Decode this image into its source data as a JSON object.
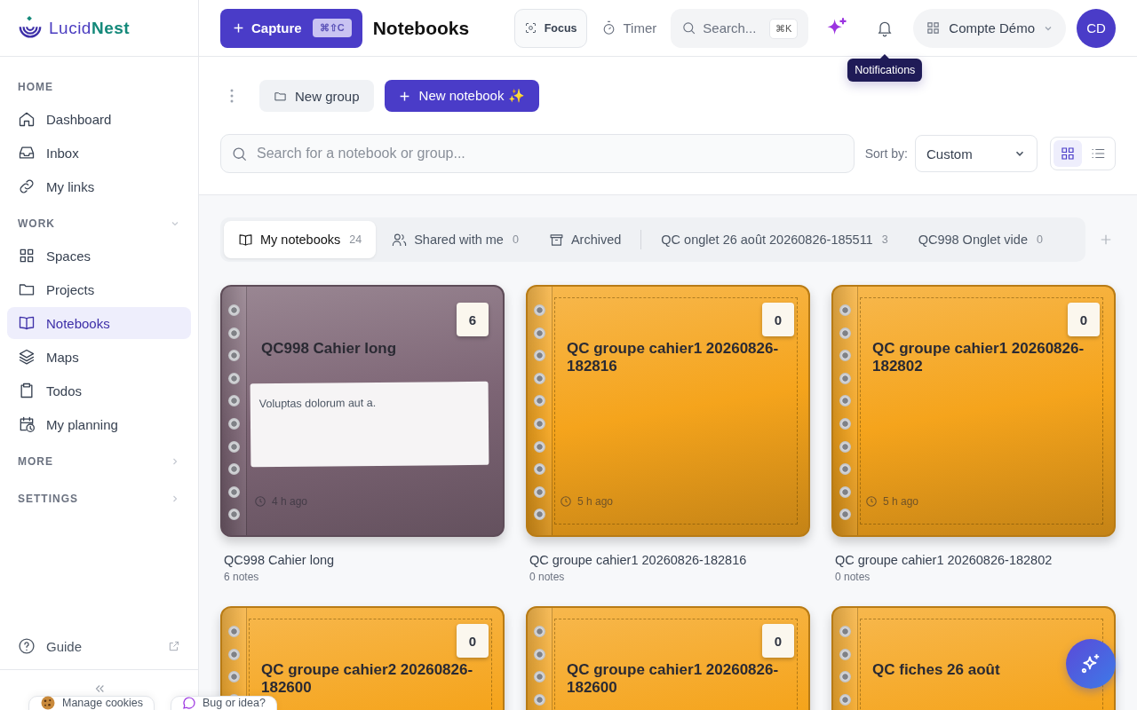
{
  "logo": {
    "first": "Lucid",
    "second": "Nest"
  },
  "sidebar": {
    "sections": [
      {
        "title": "HOME",
        "kind": "fixed",
        "items": [
          {
            "label": "Dashboard",
            "selected": false
          },
          {
            "label": "Inbox",
            "selected": false
          },
          {
            "label": "My links",
            "selected": false
          }
        ]
      },
      {
        "title": "WORK",
        "kind": "collapsible",
        "expanded": true,
        "items": [
          {
            "label": "Spaces",
            "selected": false
          },
          {
            "label": "Projects",
            "selected": false
          },
          {
            "label": "Notebooks",
            "selected": true
          },
          {
            "label": "Maps",
            "selected": false
          },
          {
            "label": "Todos",
            "selected": false
          },
          {
            "label": "My planning",
            "selected": false
          }
        ]
      },
      {
        "title": "MORE",
        "kind": "collapsible",
        "expanded": false
      },
      {
        "title": "SETTINGS",
        "kind": "collapsible",
        "expanded": false
      }
    ],
    "guide": "Guide"
  },
  "header": {
    "capture": {
      "label": "Capture",
      "shortcut": "⌘⇧C"
    },
    "title": "Notebooks",
    "focus": "Focus",
    "timer": "Timer",
    "search": {
      "placeholder": "Search...",
      "shortcut": "⌘K"
    },
    "account": "Compte Démo",
    "avatar": "CD",
    "tooltip": "Notifications"
  },
  "toolbar": {
    "new_group": "New group",
    "new_notebook": "New notebook ✨",
    "search_placeholder": "Search for a notebook or group...",
    "sort_label": "Sort by:",
    "sort_value": "Custom",
    "views": [
      {
        "selected": true
      },
      {
        "selected": false
      }
    ]
  },
  "tabs": [
    {
      "label": "My notebooks",
      "count": "24",
      "kind": "builtin",
      "selected": true
    },
    {
      "label": "Shared with me",
      "count": "0",
      "kind": "builtin",
      "selected": false
    },
    {
      "label": "Archived",
      "kind": "builtin",
      "selected": false
    },
    {
      "label": "QC onglet 26 août 20260826-185511",
      "count": "3",
      "kind": "custom",
      "selected": false
    },
    {
      "label": "QC998 Onglet vide",
      "count": "0",
      "kind": "custom",
      "selected": false
    }
  ],
  "cards": [
    {
      "title": "QC998 Cahier long",
      "count": "6",
      "color": "#7d6575",
      "preview": "Voluptas dolorum aut a.",
      "ago": "4 h ago",
      "name": "QC998 Cahier long",
      "notes": "6 notes"
    },
    {
      "title": "QC groupe cahier1 20260826-182816",
      "count": "0",
      "color": "#f5a41c",
      "ago": "5 h ago",
      "name": "QC groupe cahier1 20260826-182816",
      "notes": "0 notes"
    },
    {
      "title": "QC groupe cahier1 20260826-182802",
      "count": "0",
      "color": "#f5a41c",
      "ago": "5 h ago",
      "name": "QC groupe cahier1 20260826-182802",
      "notes": "0 notes"
    },
    {
      "title": "QC groupe cahier2 20260826-182600",
      "count": "0",
      "color": "#f5a41c"
    },
    {
      "title": "QC groupe cahier1 20260826-182600",
      "count": "0",
      "color": "#f5a41c"
    },
    {
      "title": "QC fiches 26 août",
      "color": "#f5a41c"
    }
  ],
  "floating": {
    "cookies": "Manage cookies",
    "bug": "Bug or idea?"
  }
}
